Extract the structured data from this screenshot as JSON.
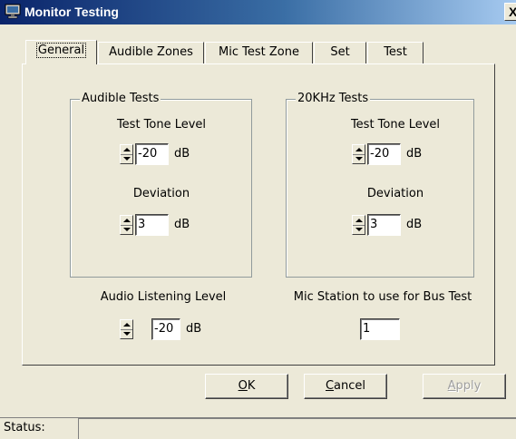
{
  "window": {
    "title": "Monitor Testing",
    "close_glyph": "X",
    "title_icon": "monitor-icon"
  },
  "tabs": [
    {
      "label": "General",
      "active": true
    },
    {
      "label": "Audible Zones",
      "active": false
    },
    {
      "label": "Mic Test Zone",
      "active": false
    },
    {
      "label": "Set",
      "active": false
    },
    {
      "label": "Test",
      "active": false
    }
  ],
  "audible_tests": {
    "title": "Audible Tests",
    "tone_label": "Test Tone Level",
    "tone_value": "-20",
    "tone_unit": "dB",
    "deviation_label": "Deviation",
    "deviation_value": "3",
    "deviation_unit": "dB"
  },
  "khz_tests": {
    "title": "20KHz Tests",
    "tone_label": "Test Tone Level",
    "tone_value": "-20",
    "tone_unit": "dB",
    "deviation_label": "Deviation",
    "deviation_value": "3",
    "deviation_unit": "dB"
  },
  "audio_listening": {
    "label": "Audio Listening Level",
    "value": "-20",
    "unit": "dB"
  },
  "mic_station": {
    "label": "Mic Station to use for Bus Test",
    "value": "1"
  },
  "buttons": {
    "ok_mnemonic": "O",
    "ok_rest": "K",
    "cancel_mnemonic": "C",
    "cancel_rest": "ancel",
    "apply_mnemonic": "A",
    "apply_rest": "pply"
  },
  "status": {
    "label": "Status:",
    "text": ""
  }
}
